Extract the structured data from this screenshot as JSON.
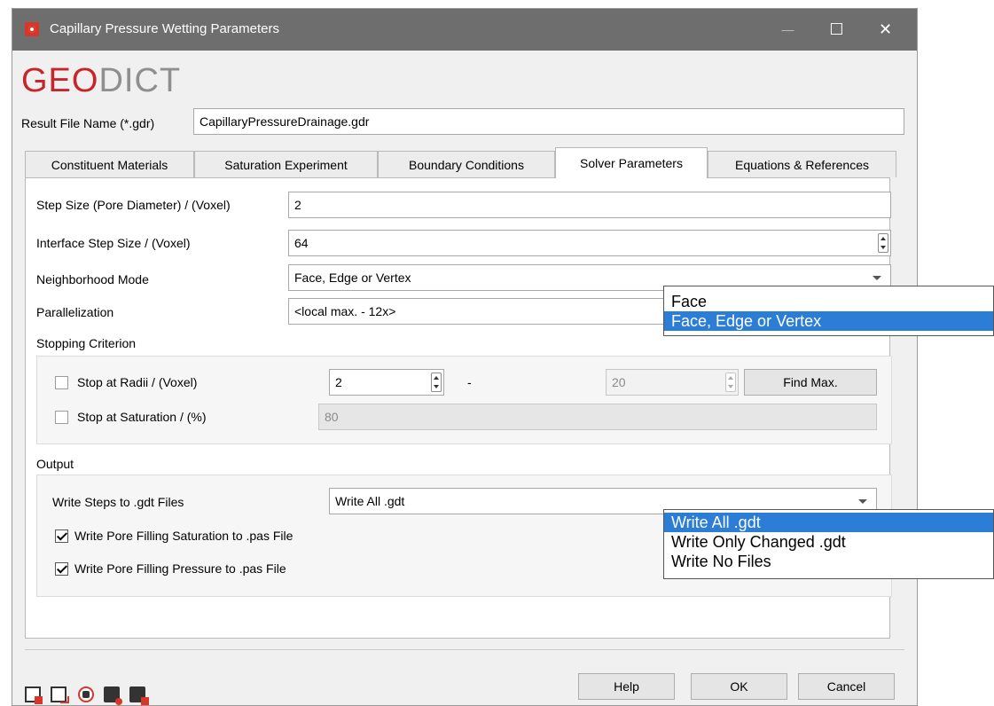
{
  "window": {
    "title": "Capillary Pressure Wetting Parameters",
    "minimize_glyph": "—",
    "maximize_glyph": "☐",
    "close_glyph": "✕"
  },
  "logo": {
    "part1": "GEO",
    "part2": "DICT"
  },
  "result_file": {
    "label": "Result File Name (*.gdr)",
    "value": "CapillaryPressureDrainage.gdr"
  },
  "tabs": [
    {
      "label": "Constituent Materials"
    },
    {
      "label": "Saturation Experiment"
    },
    {
      "label": "Boundary Conditions"
    },
    {
      "label": "Solver Parameters"
    },
    {
      "label": "Equations & References"
    }
  ],
  "solver": {
    "step_size": {
      "label": "Step Size (Pore Diameter) / (Voxel)",
      "value": "2"
    },
    "interface_step": {
      "label": "Interface Step Size / (Voxel)",
      "value": "64"
    },
    "neighborhood": {
      "label": "Neighborhood Mode",
      "value": "Face, Edge or Vertex"
    },
    "parallelization": {
      "label": "Parallelization",
      "value": "<local max. - 12x>"
    }
  },
  "stopping": {
    "title": "Stopping Criterion",
    "radii_label": "Stop at Radii / (Voxel)",
    "radii_min": "2",
    "dash": "-",
    "radii_max": "20",
    "find_max": "Find Max.",
    "saturation_label": "Stop at Saturation / (%)",
    "saturation_value": "80"
  },
  "output": {
    "title": "Output",
    "write_steps_label": "Write Steps to .gdt Files",
    "write_steps_value": "Write All .gdt",
    "pore_saturation_label": "Write Pore Filling Saturation to .pas File",
    "pore_pressure_label": "Write Pore Filling Pressure to .pas File"
  },
  "neighborhood_dropdown": [
    "Face",
    "Face, Edge or Vertex"
  ],
  "write_steps_dropdown": [
    "Write All .gdt",
    "Write Only Changed .gdt",
    "Write No Files"
  ],
  "buttons": {
    "help": "Help",
    "ok": "OK",
    "cancel": "Cancel"
  },
  "colors": {
    "title_bar": "#6e6e6e",
    "accent": "#c8242a",
    "selection": "#2b7dd6"
  }
}
